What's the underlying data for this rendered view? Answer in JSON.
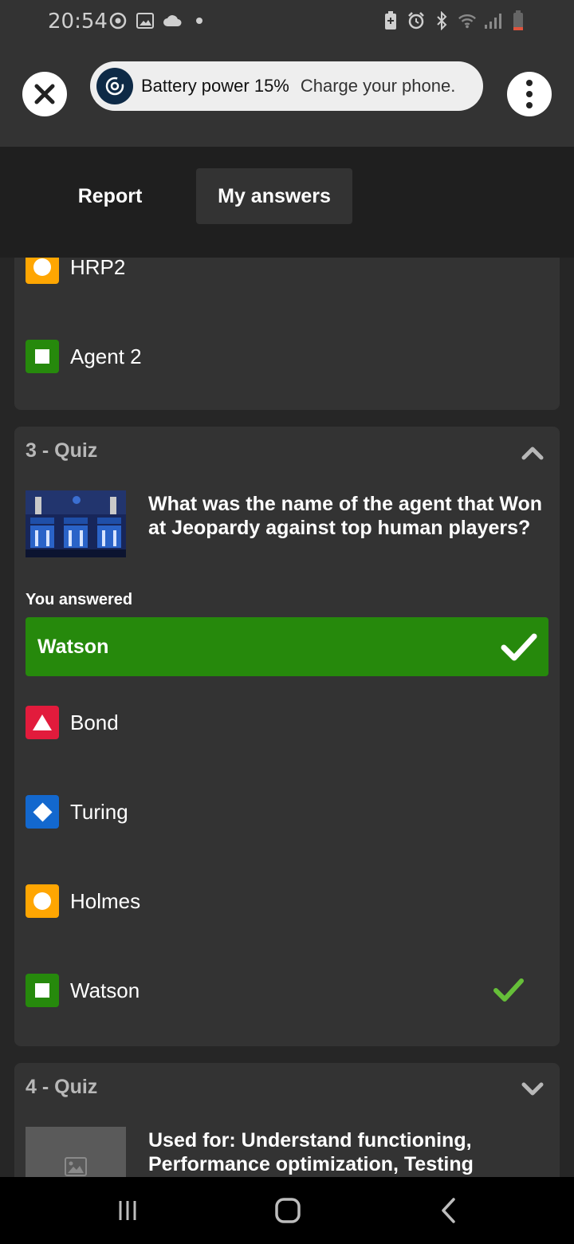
{
  "status_bar": {
    "time": "20:54",
    "left_icons": [
      "sync-icon",
      "image-icon",
      "cloud-icon",
      "dot-icon"
    ],
    "right_icons": [
      "battery-saver-icon",
      "alarm-icon",
      "bluetooth-icon",
      "wifi-icon",
      "signal-icon",
      "battery-low-icon"
    ]
  },
  "toast": {
    "title": "Battery power 15%",
    "message": "Charge your phone."
  },
  "tabs": {
    "report": "Report",
    "my_answers": "My answers"
  },
  "prev_card": {
    "options": [
      {
        "label": "HRP2",
        "shape": "circle",
        "color": "#ffa602"
      },
      {
        "label": "Agent 2",
        "shape": "square",
        "color": "#26890c"
      }
    ]
  },
  "quiz3": {
    "header": "3 - Quiz",
    "question": "What was the name of the agent that Won at Jeopardy against top human players?",
    "you_answered_label": "You answered",
    "selected_answer": "Watson",
    "options": [
      {
        "label": "Bond",
        "shape": "triangle",
        "color": "#e21b3c"
      },
      {
        "label": "Turing",
        "shape": "diamond",
        "color": "#1368ce"
      },
      {
        "label": "Holmes",
        "shape": "circle",
        "color": "#ffa602"
      },
      {
        "label": "Watson",
        "shape": "square",
        "color": "#26890c",
        "correct": true
      }
    ]
  },
  "quiz4": {
    "header": "4 - Quiz",
    "question": "Used for: Understand functioning, Performance optimization, Testing"
  },
  "colors": {
    "correct_green": "#26890c",
    "check_green": "#66bf39",
    "background": "#262626",
    "card": "#333333"
  }
}
